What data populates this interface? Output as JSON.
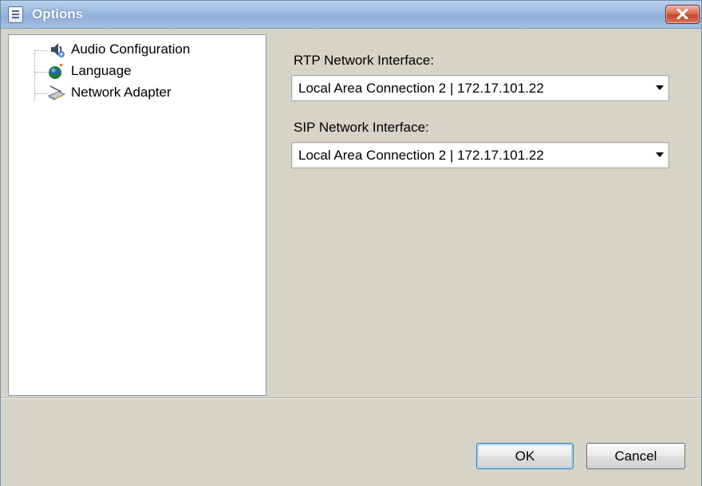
{
  "window": {
    "title": "Options"
  },
  "tree": {
    "items": [
      {
        "label": "Audio Configuration",
        "icon": "audio-icon"
      },
      {
        "label": "Language",
        "icon": "globe-icon"
      },
      {
        "label": "Network Adapter",
        "icon": "network-adapter-icon"
      }
    ]
  },
  "network": {
    "rtp_label": "RTP Network Interface:",
    "rtp_value": "Local Area Connection 2 | 172.17.101.22",
    "sip_label": "SIP Network Interface:",
    "sip_value": "Local Area Connection 2 | 172.17.101.22"
  },
  "buttons": {
    "ok": "OK",
    "cancel": "Cancel"
  },
  "colors": {
    "title_bar": "#9dbbe0",
    "dialog_face": "#d6d3c7",
    "close_button": "#c1462a",
    "default_button_border": "#3c7fb1"
  }
}
